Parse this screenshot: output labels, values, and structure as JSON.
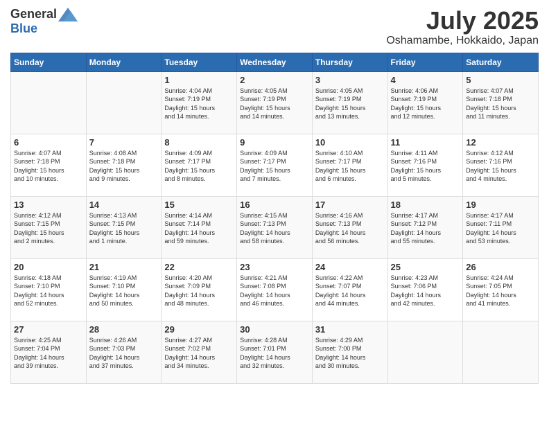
{
  "logo": {
    "general": "General",
    "blue": "Blue"
  },
  "title": "July 2025",
  "location": "Oshamambe, Hokkaido, Japan",
  "days_of_week": [
    "Sunday",
    "Monday",
    "Tuesday",
    "Wednesday",
    "Thursday",
    "Friday",
    "Saturday"
  ],
  "weeks": [
    [
      {
        "day": "",
        "info": ""
      },
      {
        "day": "",
        "info": ""
      },
      {
        "day": "1",
        "info": "Sunrise: 4:04 AM\nSunset: 7:19 PM\nDaylight: 15 hours\nand 14 minutes."
      },
      {
        "day": "2",
        "info": "Sunrise: 4:05 AM\nSunset: 7:19 PM\nDaylight: 15 hours\nand 14 minutes."
      },
      {
        "day": "3",
        "info": "Sunrise: 4:05 AM\nSunset: 7:19 PM\nDaylight: 15 hours\nand 13 minutes."
      },
      {
        "day": "4",
        "info": "Sunrise: 4:06 AM\nSunset: 7:19 PM\nDaylight: 15 hours\nand 12 minutes."
      },
      {
        "day": "5",
        "info": "Sunrise: 4:07 AM\nSunset: 7:18 PM\nDaylight: 15 hours\nand 11 minutes."
      }
    ],
    [
      {
        "day": "6",
        "info": "Sunrise: 4:07 AM\nSunset: 7:18 PM\nDaylight: 15 hours\nand 10 minutes."
      },
      {
        "day": "7",
        "info": "Sunrise: 4:08 AM\nSunset: 7:18 PM\nDaylight: 15 hours\nand 9 minutes."
      },
      {
        "day": "8",
        "info": "Sunrise: 4:09 AM\nSunset: 7:17 PM\nDaylight: 15 hours\nand 8 minutes."
      },
      {
        "day": "9",
        "info": "Sunrise: 4:09 AM\nSunset: 7:17 PM\nDaylight: 15 hours\nand 7 minutes."
      },
      {
        "day": "10",
        "info": "Sunrise: 4:10 AM\nSunset: 7:17 PM\nDaylight: 15 hours\nand 6 minutes."
      },
      {
        "day": "11",
        "info": "Sunrise: 4:11 AM\nSunset: 7:16 PM\nDaylight: 15 hours\nand 5 minutes."
      },
      {
        "day": "12",
        "info": "Sunrise: 4:12 AM\nSunset: 7:16 PM\nDaylight: 15 hours\nand 4 minutes."
      }
    ],
    [
      {
        "day": "13",
        "info": "Sunrise: 4:12 AM\nSunset: 7:15 PM\nDaylight: 15 hours\nand 2 minutes."
      },
      {
        "day": "14",
        "info": "Sunrise: 4:13 AM\nSunset: 7:15 PM\nDaylight: 15 hours\nand 1 minute."
      },
      {
        "day": "15",
        "info": "Sunrise: 4:14 AM\nSunset: 7:14 PM\nDaylight: 14 hours\nand 59 minutes."
      },
      {
        "day": "16",
        "info": "Sunrise: 4:15 AM\nSunset: 7:13 PM\nDaylight: 14 hours\nand 58 minutes."
      },
      {
        "day": "17",
        "info": "Sunrise: 4:16 AM\nSunset: 7:13 PM\nDaylight: 14 hours\nand 56 minutes."
      },
      {
        "day": "18",
        "info": "Sunrise: 4:17 AM\nSunset: 7:12 PM\nDaylight: 14 hours\nand 55 minutes."
      },
      {
        "day": "19",
        "info": "Sunrise: 4:17 AM\nSunset: 7:11 PM\nDaylight: 14 hours\nand 53 minutes."
      }
    ],
    [
      {
        "day": "20",
        "info": "Sunrise: 4:18 AM\nSunset: 7:10 PM\nDaylight: 14 hours\nand 52 minutes."
      },
      {
        "day": "21",
        "info": "Sunrise: 4:19 AM\nSunset: 7:10 PM\nDaylight: 14 hours\nand 50 minutes."
      },
      {
        "day": "22",
        "info": "Sunrise: 4:20 AM\nSunset: 7:09 PM\nDaylight: 14 hours\nand 48 minutes."
      },
      {
        "day": "23",
        "info": "Sunrise: 4:21 AM\nSunset: 7:08 PM\nDaylight: 14 hours\nand 46 minutes."
      },
      {
        "day": "24",
        "info": "Sunrise: 4:22 AM\nSunset: 7:07 PM\nDaylight: 14 hours\nand 44 minutes."
      },
      {
        "day": "25",
        "info": "Sunrise: 4:23 AM\nSunset: 7:06 PM\nDaylight: 14 hours\nand 42 minutes."
      },
      {
        "day": "26",
        "info": "Sunrise: 4:24 AM\nSunset: 7:05 PM\nDaylight: 14 hours\nand 41 minutes."
      }
    ],
    [
      {
        "day": "27",
        "info": "Sunrise: 4:25 AM\nSunset: 7:04 PM\nDaylight: 14 hours\nand 39 minutes."
      },
      {
        "day": "28",
        "info": "Sunrise: 4:26 AM\nSunset: 7:03 PM\nDaylight: 14 hours\nand 37 minutes."
      },
      {
        "day": "29",
        "info": "Sunrise: 4:27 AM\nSunset: 7:02 PM\nDaylight: 14 hours\nand 34 minutes."
      },
      {
        "day": "30",
        "info": "Sunrise: 4:28 AM\nSunset: 7:01 PM\nDaylight: 14 hours\nand 32 minutes."
      },
      {
        "day": "31",
        "info": "Sunrise: 4:29 AM\nSunset: 7:00 PM\nDaylight: 14 hours\nand 30 minutes."
      },
      {
        "day": "",
        "info": ""
      },
      {
        "day": "",
        "info": ""
      }
    ]
  ]
}
